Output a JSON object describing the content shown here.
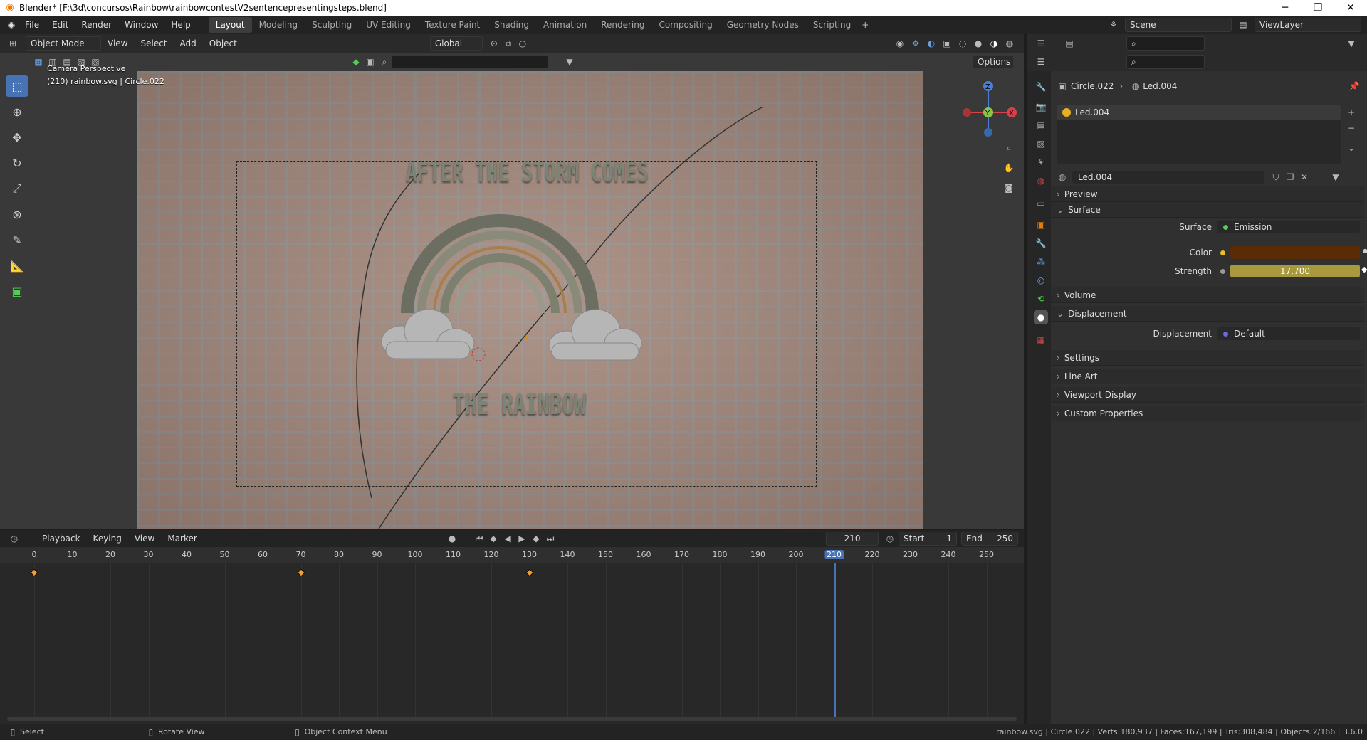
{
  "titlebar": {
    "title": "Blender* [F:\\3d\\concursos\\Rainbow\\rainbowcontestV2sentencepresentingsteps.blend]"
  },
  "menu": [
    "File",
    "Edit",
    "Render",
    "Window",
    "Help"
  ],
  "workspaces": [
    "Layout",
    "Modeling",
    "Sculpting",
    "UV Editing",
    "Texture Paint",
    "Shading",
    "Animation",
    "Rendering",
    "Compositing",
    "Geometry Nodes",
    "Scripting"
  ],
  "scene": {
    "label": "Scene",
    "viewlayer": "ViewLayer"
  },
  "viewport": {
    "mode": "Object Mode",
    "menus": [
      "View",
      "Select",
      "Add",
      "Object"
    ],
    "orientation": "Global",
    "options": "Options",
    "overlay_line1": "Camera Perspective",
    "overlay_line2": "(210) rainbow.svg | Circle.022",
    "text_top": "AFTER THE STORM COMES",
    "text_bottom": "THE RAINBOW"
  },
  "properties": {
    "breadcrumb_object": "Circle.022",
    "breadcrumb_material": "Led.004",
    "slot": "Led.004",
    "material_name": "Led.004",
    "sections": {
      "preview": "Preview",
      "surface": "Surface",
      "volume": "Volume",
      "displacement": "Displacement",
      "settings": "Settings",
      "lineart": "Line Art",
      "viewport_display": "Viewport Display",
      "custom": "Custom Properties"
    },
    "surface_label": "Surface",
    "surface_value": "Emission",
    "color_label": "Color",
    "color_value": "#5a2c06",
    "strength_label": "Strength",
    "strength_value": "17.700",
    "displacement_label": "Displacement",
    "displacement_value": "Default"
  },
  "timeline": {
    "menus": [
      "Playback",
      "Keying",
      "View",
      "Marker"
    ],
    "current_frame": "210",
    "start_label": "Start",
    "start_value": "1",
    "end_label": "End",
    "end_value": "250",
    "ticks": [
      "0",
      "10",
      "20",
      "30",
      "40",
      "50",
      "60",
      "70",
      "80",
      "90",
      "100",
      "110",
      "120",
      "130",
      "140",
      "150",
      "160",
      "170",
      "180",
      "190",
      "200",
      "210",
      "220",
      "230",
      "240",
      "250"
    ],
    "keyframes": [
      0,
      70,
      130
    ]
  },
  "statusbar": {
    "select": "Select",
    "rotate": "Rotate View",
    "context": "Object Context Menu",
    "stats": "rainbow.svg | Circle.022 | Verts:180,937 | Faces:167,199 | Tris:308,484 | Objects:2/166 | 3.6.0"
  }
}
